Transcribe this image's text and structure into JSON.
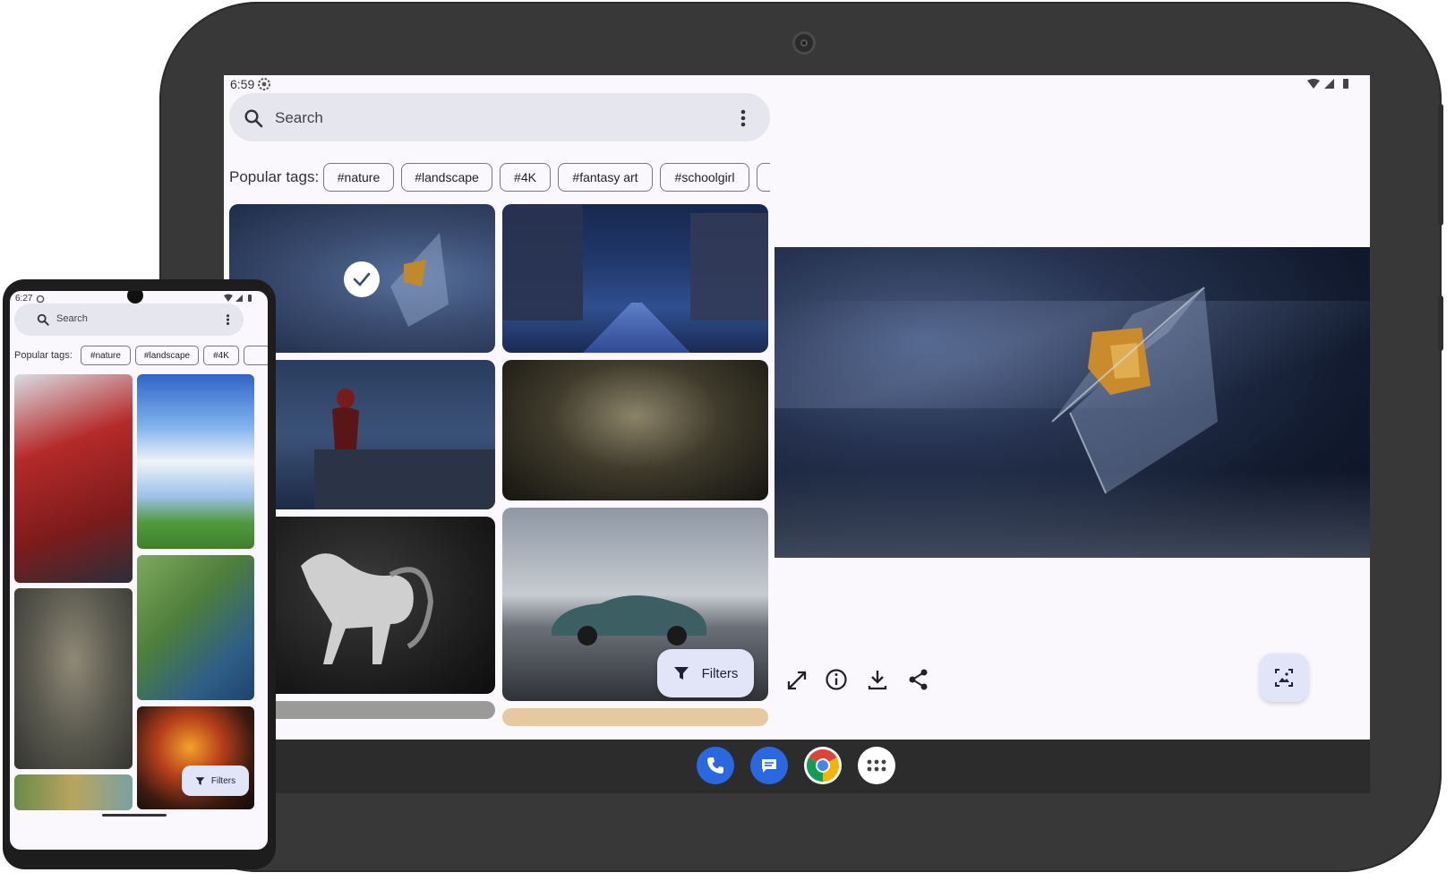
{
  "tablet": {
    "status": {
      "time": "6:59"
    },
    "search": {
      "placeholder": "Search"
    },
    "tags_label": "Popular tags:",
    "tags": [
      "#nature",
      "#landscape",
      "#4K",
      "#fantasy art",
      "#schoolgirl"
    ],
    "filters_label": "Filters",
    "grid": [
      {
        "name": "space-telescope",
        "selected": true
      },
      {
        "name": "night-city-street"
      },
      {
        "name": "spiderman-rain"
      },
      {
        "name": "dark-scene"
      },
      {
        "name": "horse-sculpture"
      },
      {
        "name": "sports-car"
      }
    ],
    "detail": {
      "image": "space-telescope"
    },
    "actions": [
      "fullscreen-icon",
      "info-icon",
      "download-icon",
      "share-icon",
      "set-wallpaper-icon"
    ],
    "dock": [
      {
        "name": "phone-app-icon",
        "color": "#2a68e2"
      },
      {
        "name": "messages-app-icon",
        "color": "#2a68e2"
      },
      {
        "name": "chrome-app-icon",
        "color": "#ffffff"
      },
      {
        "name": "app-drawer-icon",
        "color": "#ffffff"
      }
    ]
  },
  "phone": {
    "status": {
      "time": "6:27"
    },
    "search": {
      "placeholder": "Search"
    },
    "tags_label": "Popular tags:",
    "tags": [
      "#nature",
      "#landscape",
      "#4K"
    ],
    "filters_label": "Filters",
    "grid": [
      {
        "name": "spiderman-suit"
      },
      {
        "name": "clouds-field"
      },
      {
        "name": "fantasy-warrior"
      },
      {
        "name": "soccer-field"
      },
      {
        "name": "fire-creature"
      },
      {
        "name": "landscape-painting"
      }
    ]
  },
  "colors": {
    "accent": "#e2e4f7",
    "screen_bg": "#fbf8fd",
    "search_bg": "#e6e6ef"
  }
}
